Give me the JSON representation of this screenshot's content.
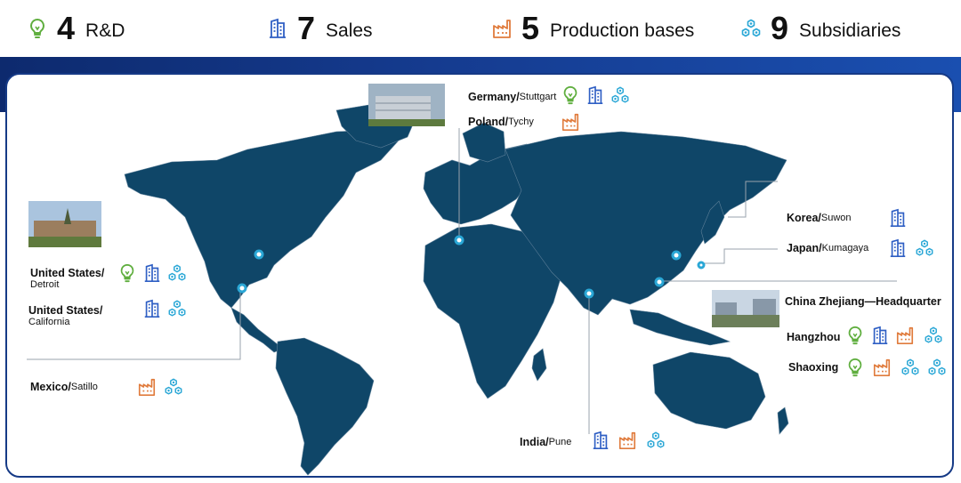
{
  "stats": [
    {
      "icon": "lightbulb-icon",
      "number": "4",
      "label": "R&D"
    },
    {
      "icon": "office-building-icon",
      "number": "7",
      "label": "Sales"
    },
    {
      "icon": "factory-icon",
      "number": "5",
      "label": "Production bases"
    },
    {
      "icon": "subsidiary-network-icon",
      "number": "9",
      "label": "Subsidiaries"
    }
  ],
  "colors": {
    "rd": "#5fae3e",
    "sales": "#2f5fc4",
    "production": "#e07b3c",
    "subsidiary": "#2aa7d6",
    "map_land": "#0f4668",
    "accent": "#163a86"
  },
  "locations": {
    "germany": {
      "country": "Germany/",
      "city": " Stuttgart"
    },
    "poland": {
      "country": "Poland/",
      "city": " Tychy"
    },
    "korea": {
      "country": "Korea/",
      "city": " Suwon"
    },
    "japan": {
      "country": "Japan/",
      "city": " Kumagaya"
    },
    "china": {
      "country": "China Zhejiang—Headquarter"
    },
    "hangzhou": {
      "country": "Hangzhou"
    },
    "shaoxing": {
      "country": "Shaoxing"
    },
    "us_detroit": {
      "country": "United States/",
      "city": "Detroit"
    },
    "us_california": {
      "country": "United States/",
      "city": "California"
    },
    "mexico": {
      "country": "Mexico/",
      "city": "Satillo"
    },
    "india": {
      "country": "India/",
      "city": " Pune"
    }
  }
}
